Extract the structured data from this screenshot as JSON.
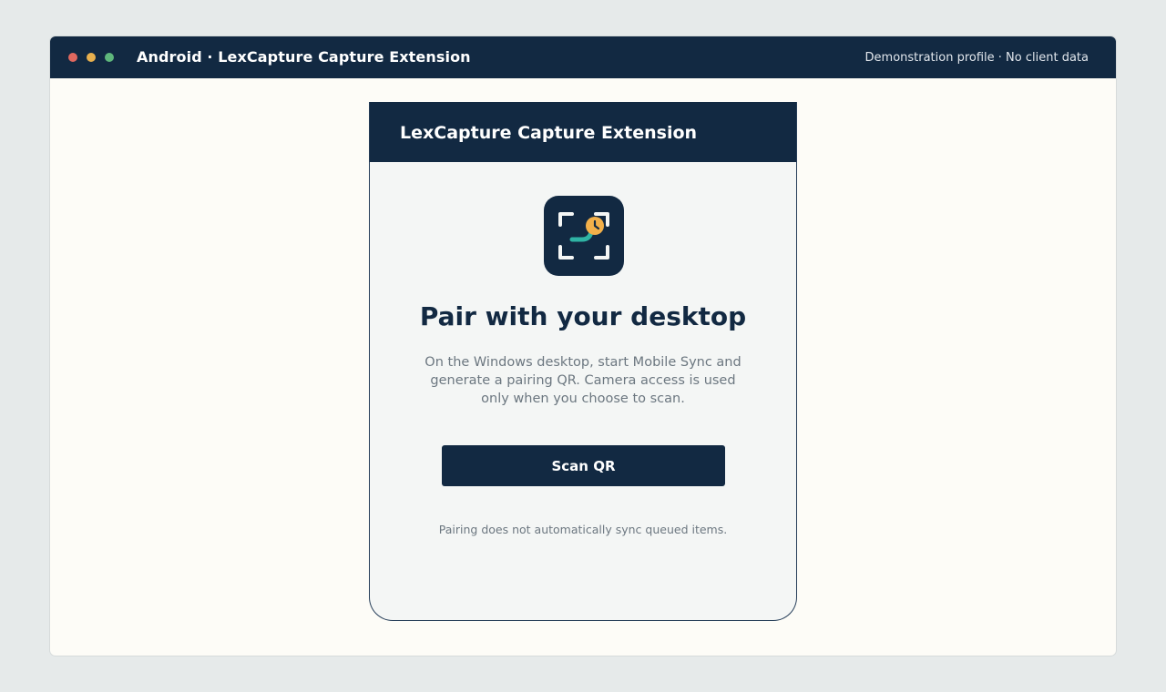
{
  "window": {
    "title": "Android · LexCapture Capture Extension",
    "profile_note": "Demonstration profile · No client data"
  },
  "app": {
    "header_title": "LexCapture Capture Extension",
    "icon": "qr-scan-clock-icon",
    "headline": "Pair with your desktop",
    "description": "On the Windows desktop, start Mobile Sync and generate a pairing QR. Camera access is used only when you choose to scan.",
    "scan_button_label": "Scan QR",
    "footnote": "Pairing does not automatically sync queued items."
  },
  "colors": {
    "navy": "#122942",
    "accent_teal": "#2fb3a4",
    "accent_orange": "#f2b04a",
    "window_bg": "#fdfcf7",
    "desktop_bg": "#e6eaea"
  }
}
